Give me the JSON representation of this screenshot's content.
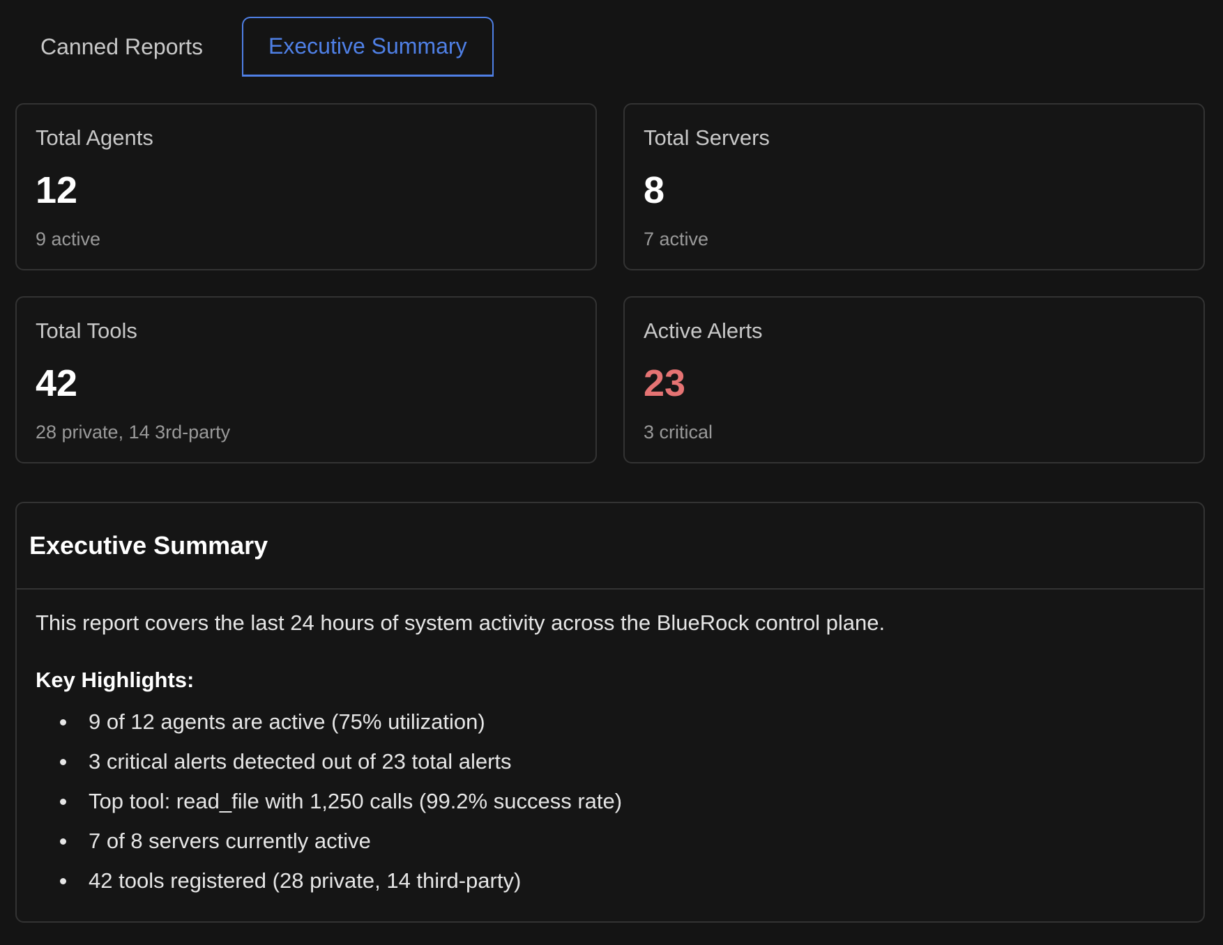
{
  "tabs": [
    {
      "label": "Canned Reports",
      "active": false
    },
    {
      "label": "Executive Summary",
      "active": true
    }
  ],
  "colors": {
    "accent": "#4f80e6",
    "alert": "#e57373",
    "background": "#141414",
    "border": "#333333"
  },
  "cards": {
    "agents": {
      "label": "Total Agents",
      "value": "12",
      "sub": "9 active"
    },
    "servers": {
      "label": "Total Servers",
      "value": "8",
      "sub": "7 active"
    },
    "tools": {
      "label": "Total Tools",
      "value": "42",
      "sub": "28 private, 14 3rd-party"
    },
    "alerts": {
      "label": "Active Alerts",
      "value": "23",
      "sub": "3 critical"
    }
  },
  "summary": {
    "title": "Executive Summary",
    "intro": "This report covers the last 24 hours of system activity across the BlueRock control plane.",
    "highlights_title": "Key Highlights:",
    "highlights": [
      "9 of 12 agents are active (75% utilization)",
      "3 critical alerts detected out of 23 total alerts",
      "Top tool: read_file with 1,250 calls (99.2% success rate)",
      "7 of 8 servers currently active",
      "42 tools registered (28 private, 14 third-party)"
    ]
  }
}
